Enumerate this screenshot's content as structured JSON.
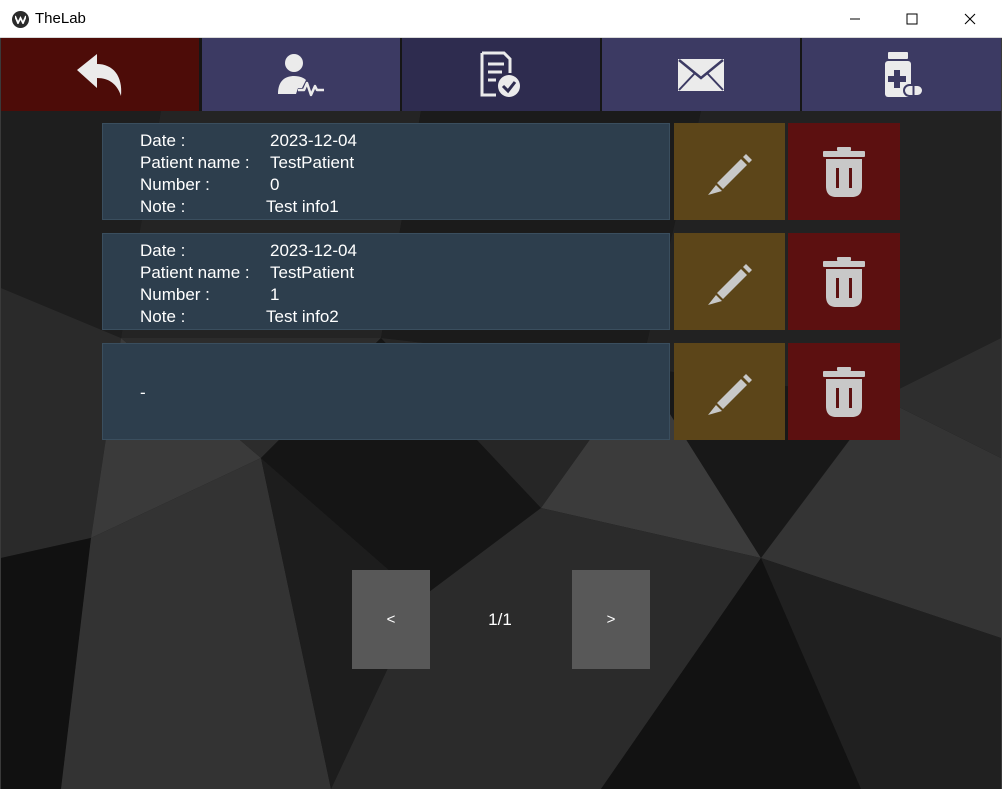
{
  "window": {
    "title": "TheLab",
    "logo_icon": "thelab-logo-icon",
    "controls": [
      "minimize-icon",
      "maximize-icon",
      "close-icon"
    ]
  },
  "nav": {
    "items": [
      {
        "name": "back",
        "icon": "back-arrow-icon",
        "color": "#4d0c08"
      },
      {
        "name": "patients",
        "icon": "patient-vitals-icon",
        "color": "#3c3a63"
      },
      {
        "name": "reports",
        "icon": "report-checked-icon",
        "color": "#2e2c4f"
      },
      {
        "name": "messages",
        "icon": "envelope-icon",
        "color": "#3c3a63"
      },
      {
        "name": "medication",
        "icon": "medicine-bottle-icon",
        "color": "#3c3a63"
      }
    ]
  },
  "records": {
    "labels": {
      "date": "Date :",
      "patient": "Patient name :",
      "number": "Number :",
      "note": "Note :"
    },
    "items": [
      {
        "date": "2023-12-04",
        "patient": "TestPatient",
        "number": "0",
        "note": "Test info1"
      },
      {
        "date": "2023-12-04",
        "patient": "TestPatient",
        "number": "1",
        "note": "Test info2"
      }
    ],
    "empty_text": "-",
    "edit_icon": "pencil-icon",
    "delete_icon": "trash-icon",
    "colors": {
      "row": "#2d3e4d",
      "edit": "#5c4519",
      "delete": "#5c1010"
    }
  },
  "pagination": {
    "prev_label": "<",
    "next_label": ">",
    "indicator": "1/1"
  }
}
